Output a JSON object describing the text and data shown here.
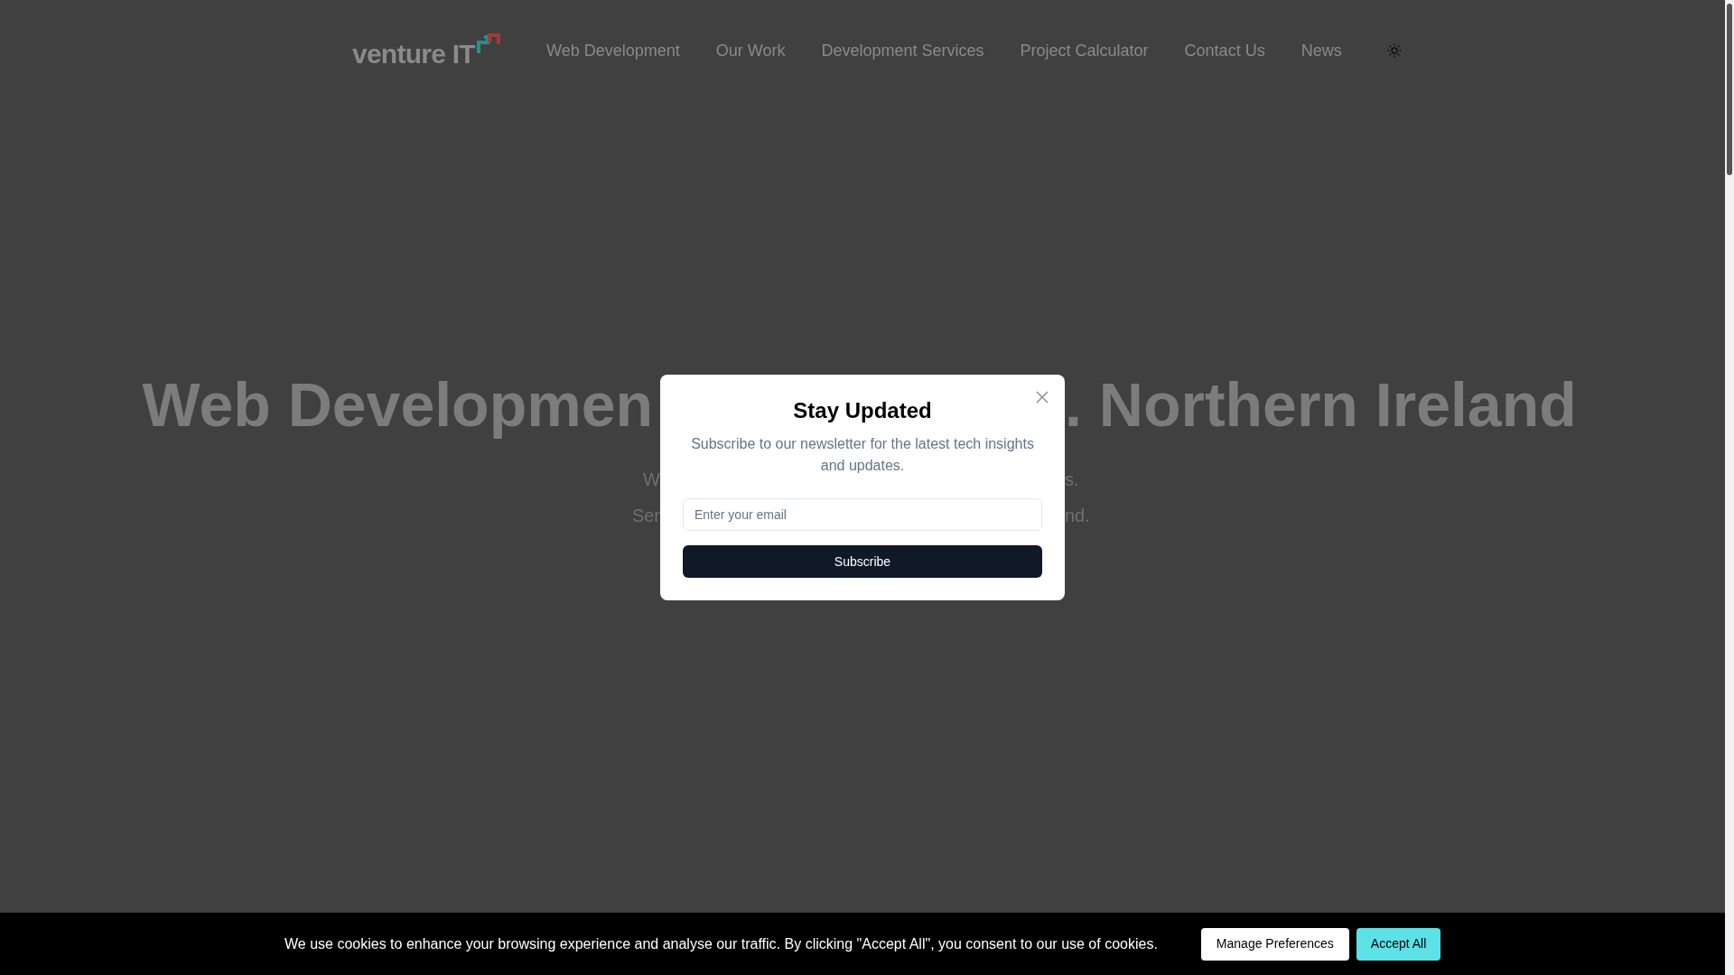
{
  "header": {
    "logo": "venture IT",
    "nav": [
      {
        "label": "Web Development"
      },
      {
        "label": "Our Work"
      },
      {
        "label": "Development Services"
      },
      {
        "label": "Project Calculator"
      },
      {
        "label": "Contact Us"
      },
      {
        "label": "News"
      }
    ]
  },
  "hero": {
    "title_left": "Web Developmen",
    "title_right": ". Northern Ireland",
    "subtitle_lines": [
      {
        "left": "W",
        "right": "s."
      },
      {
        "left": "Ser",
        "right": "nd."
      }
    ]
  },
  "modal": {
    "title": "Stay Updated",
    "description": "Subscribe to our newsletter for the latest tech insights and updates.",
    "email": {
      "placeholder": "Enter your email"
    },
    "button": "Subscribe"
  },
  "cookie_bar": {
    "message": "We use cookies to enhance your browsing experience and analyse our traffic. By clicking \"Accept All\", you consent to our use of cookies.",
    "buttons": [
      {
        "kind": "secondary",
        "label": "Manage Preferences"
      },
      {
        "kind": "primary",
        "label": "Accept All"
      }
    ]
  }
}
